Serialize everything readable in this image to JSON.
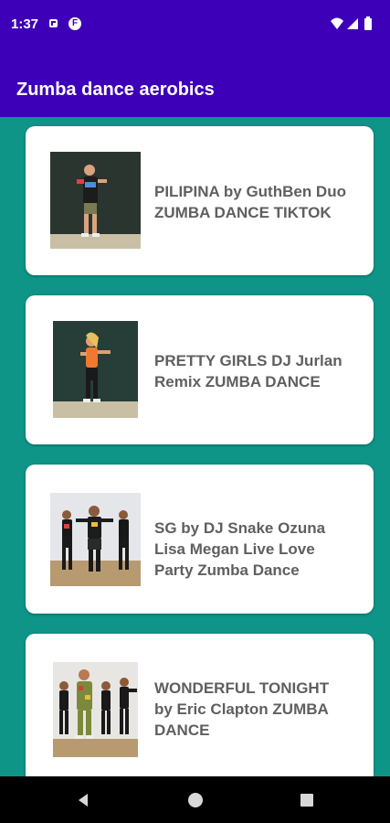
{
  "status_bar": {
    "time": "1:37",
    "icons": [
      "sim-card-icon",
      "fitness-app-icon",
      "wifi-icon",
      "signal-icon",
      "battery-icon"
    ]
  },
  "app_bar": {
    "title": "Zumba dance aerobics",
    "color": "#3d00b8"
  },
  "background_color": "#0e9588",
  "videos": [
    {
      "title_line1": "PILIPINA by GuthBen Duo",
      "title_line2": "ZUMBA DANCE TIKTOK",
      "title_line3": ""
    },
    {
      "title_line1": "PRETTY GIRLS DJ Jurlan",
      "title_line2": "Remix ZUMBA DANCE",
      "title_line3": ""
    },
    {
      "title_line1": "SG by DJ Snake Ozuna",
      "title_line2": "Lisa Megan Live Love",
      "title_line3": "Party Zumba Dance"
    },
    {
      "title_line1": "WONDERFUL TONIGHT",
      "title_line2": "by Eric Clapton ZUMBA",
      "title_line3": "DANCE"
    }
  ],
  "nav_bar": {
    "icons": [
      "back-icon",
      "home-icon",
      "recents-icon"
    ]
  }
}
